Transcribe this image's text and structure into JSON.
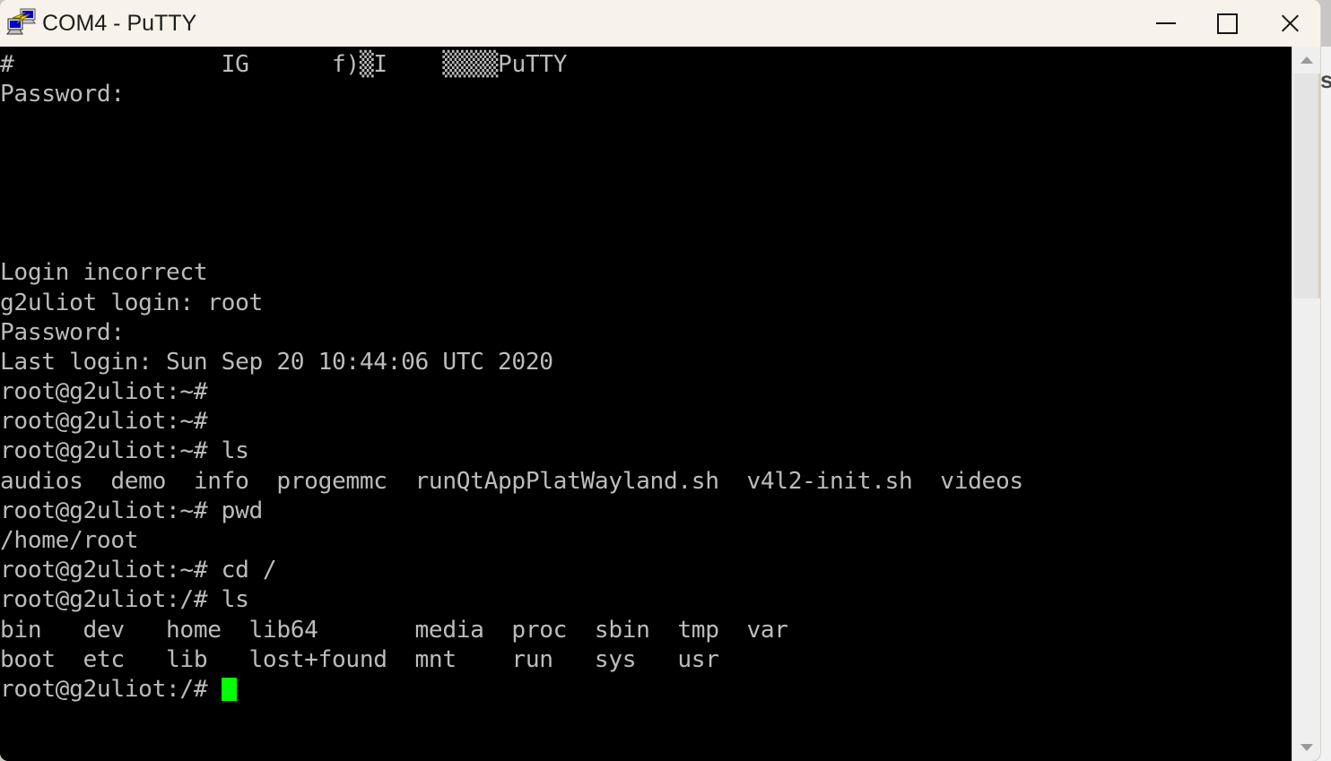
{
  "window": {
    "title": "COM4 - PuTTY",
    "icon": "putty-computers-lightning-icon",
    "controls": {
      "minimize_label": "Minimize",
      "maximize_label": "Maximize",
      "close_label": "Close"
    }
  },
  "theme": {
    "titlebar_bg": "#f7f2ea",
    "terminal_bg": "#000000",
    "terminal_fg": "#bcbcbc",
    "cursor_color": "#00ff00",
    "scrollbar_bg": "#efefef"
  },
  "desktop": {
    "bleed_glyph": "s"
  },
  "terminal": {
    "hostname": "g2uliot",
    "user": "root",
    "prompt_home": "root@g2uliot:~#",
    "prompt_root": "root@g2uliot:/#",
    "cursor": "block",
    "lines": [
      "#               IG      f)▒I    ▒▒▒▒PuTTY",
      "Password:",
      "",
      "",
      "",
      "",
      "",
      "Login incorrect",
      "g2uliot login: root",
      "Password:",
      "Last login: Sun Sep 20 10:44:06 UTC 2020",
      "root@g2uliot:~#",
      "root@g2uliot:~#",
      "root@g2uliot:~# ls",
      "audios  demo  info  progemmc  runQtAppPlatWayland.sh  v4l2-init.sh  videos",
      "root@g2uliot:~# pwd",
      "/home/root",
      "root@g2uliot:~# cd /",
      "root@g2uliot:/# ls",
      "bin   dev   home  lib64       media  proc  sbin  tmp  var",
      "boot  etc   lib   lost+found  mnt    run   sys   usr",
      "root@g2uliot:/# █"
    ],
    "commands_issued": [
      "ls",
      "pwd",
      "cd /",
      "ls"
    ],
    "home_listing": [
      "audios",
      "demo",
      "info",
      "progemmc",
      "runQtAppPlatWayland.sh",
      "v4l2-init.sh",
      "videos"
    ],
    "root_listing": [
      "bin",
      "boot",
      "dev",
      "etc",
      "home",
      "lib",
      "lib64",
      "lost+found",
      "media",
      "mnt",
      "proc",
      "run",
      "sbin",
      "sys",
      "tmp",
      "usr",
      "var"
    ],
    "pwd_output": "/home/root",
    "last_login": "Last login: Sun Sep 20 10:44:06 UTC 2020",
    "login_incorrect": "Login incorrect",
    "login_prompt": "g2uliot login: root",
    "password_prompt": "Password:"
  },
  "scrollbar": {
    "up_arrow": "scroll-up",
    "down_arrow": "scroll-down",
    "thumb_position_pct": 0,
    "thumb_size_pct": 34
  }
}
